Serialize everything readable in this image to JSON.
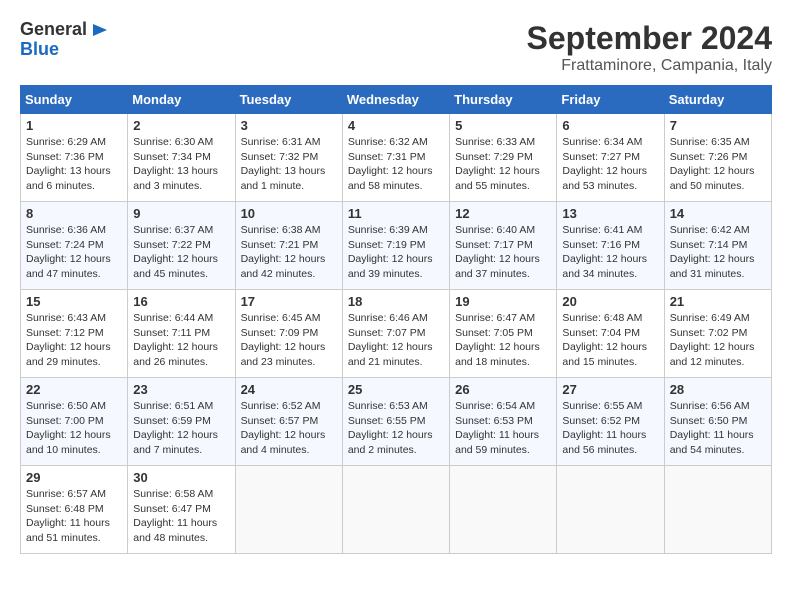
{
  "header": {
    "logo_general": "General",
    "logo_blue": "Blue",
    "month_title": "September 2024",
    "location": "Frattaminore, Campania, Italy"
  },
  "weekdays": [
    "Sunday",
    "Monday",
    "Tuesday",
    "Wednesday",
    "Thursday",
    "Friday",
    "Saturday"
  ],
  "weeks": [
    [
      {
        "day": "1",
        "info": "Sunrise: 6:29 AM\nSunset: 7:36 PM\nDaylight: 13 hours\nand 6 minutes."
      },
      {
        "day": "2",
        "info": "Sunrise: 6:30 AM\nSunset: 7:34 PM\nDaylight: 13 hours\nand 3 minutes."
      },
      {
        "day": "3",
        "info": "Sunrise: 6:31 AM\nSunset: 7:32 PM\nDaylight: 13 hours\nand 1 minute."
      },
      {
        "day": "4",
        "info": "Sunrise: 6:32 AM\nSunset: 7:31 PM\nDaylight: 12 hours\nand 58 minutes."
      },
      {
        "day": "5",
        "info": "Sunrise: 6:33 AM\nSunset: 7:29 PM\nDaylight: 12 hours\nand 55 minutes."
      },
      {
        "day": "6",
        "info": "Sunrise: 6:34 AM\nSunset: 7:27 PM\nDaylight: 12 hours\nand 53 minutes."
      },
      {
        "day": "7",
        "info": "Sunrise: 6:35 AM\nSunset: 7:26 PM\nDaylight: 12 hours\nand 50 minutes."
      }
    ],
    [
      {
        "day": "8",
        "info": "Sunrise: 6:36 AM\nSunset: 7:24 PM\nDaylight: 12 hours\nand 47 minutes."
      },
      {
        "day": "9",
        "info": "Sunrise: 6:37 AM\nSunset: 7:22 PM\nDaylight: 12 hours\nand 45 minutes."
      },
      {
        "day": "10",
        "info": "Sunrise: 6:38 AM\nSunset: 7:21 PM\nDaylight: 12 hours\nand 42 minutes."
      },
      {
        "day": "11",
        "info": "Sunrise: 6:39 AM\nSunset: 7:19 PM\nDaylight: 12 hours\nand 39 minutes."
      },
      {
        "day": "12",
        "info": "Sunrise: 6:40 AM\nSunset: 7:17 PM\nDaylight: 12 hours\nand 37 minutes."
      },
      {
        "day": "13",
        "info": "Sunrise: 6:41 AM\nSunset: 7:16 PM\nDaylight: 12 hours\nand 34 minutes."
      },
      {
        "day": "14",
        "info": "Sunrise: 6:42 AM\nSunset: 7:14 PM\nDaylight: 12 hours\nand 31 minutes."
      }
    ],
    [
      {
        "day": "15",
        "info": "Sunrise: 6:43 AM\nSunset: 7:12 PM\nDaylight: 12 hours\nand 29 minutes."
      },
      {
        "day": "16",
        "info": "Sunrise: 6:44 AM\nSunset: 7:11 PM\nDaylight: 12 hours\nand 26 minutes."
      },
      {
        "day": "17",
        "info": "Sunrise: 6:45 AM\nSunset: 7:09 PM\nDaylight: 12 hours\nand 23 minutes."
      },
      {
        "day": "18",
        "info": "Sunrise: 6:46 AM\nSunset: 7:07 PM\nDaylight: 12 hours\nand 21 minutes."
      },
      {
        "day": "19",
        "info": "Sunrise: 6:47 AM\nSunset: 7:05 PM\nDaylight: 12 hours\nand 18 minutes."
      },
      {
        "day": "20",
        "info": "Sunrise: 6:48 AM\nSunset: 7:04 PM\nDaylight: 12 hours\nand 15 minutes."
      },
      {
        "day": "21",
        "info": "Sunrise: 6:49 AM\nSunset: 7:02 PM\nDaylight: 12 hours\nand 12 minutes."
      }
    ],
    [
      {
        "day": "22",
        "info": "Sunrise: 6:50 AM\nSunset: 7:00 PM\nDaylight: 12 hours\nand 10 minutes."
      },
      {
        "day": "23",
        "info": "Sunrise: 6:51 AM\nSunset: 6:59 PM\nDaylight: 12 hours\nand 7 minutes."
      },
      {
        "day": "24",
        "info": "Sunrise: 6:52 AM\nSunset: 6:57 PM\nDaylight: 12 hours\nand 4 minutes."
      },
      {
        "day": "25",
        "info": "Sunrise: 6:53 AM\nSunset: 6:55 PM\nDaylight: 12 hours\nand 2 minutes."
      },
      {
        "day": "26",
        "info": "Sunrise: 6:54 AM\nSunset: 6:53 PM\nDaylight: 11 hours\nand 59 minutes."
      },
      {
        "day": "27",
        "info": "Sunrise: 6:55 AM\nSunset: 6:52 PM\nDaylight: 11 hours\nand 56 minutes."
      },
      {
        "day": "28",
        "info": "Sunrise: 6:56 AM\nSunset: 6:50 PM\nDaylight: 11 hours\nand 54 minutes."
      }
    ],
    [
      {
        "day": "29",
        "info": "Sunrise: 6:57 AM\nSunset: 6:48 PM\nDaylight: 11 hours\nand 51 minutes."
      },
      {
        "day": "30",
        "info": "Sunrise: 6:58 AM\nSunset: 6:47 PM\nDaylight: 11 hours\nand 48 minutes."
      },
      {
        "day": "",
        "info": ""
      },
      {
        "day": "",
        "info": ""
      },
      {
        "day": "",
        "info": ""
      },
      {
        "day": "",
        "info": ""
      },
      {
        "day": "",
        "info": ""
      }
    ]
  ]
}
